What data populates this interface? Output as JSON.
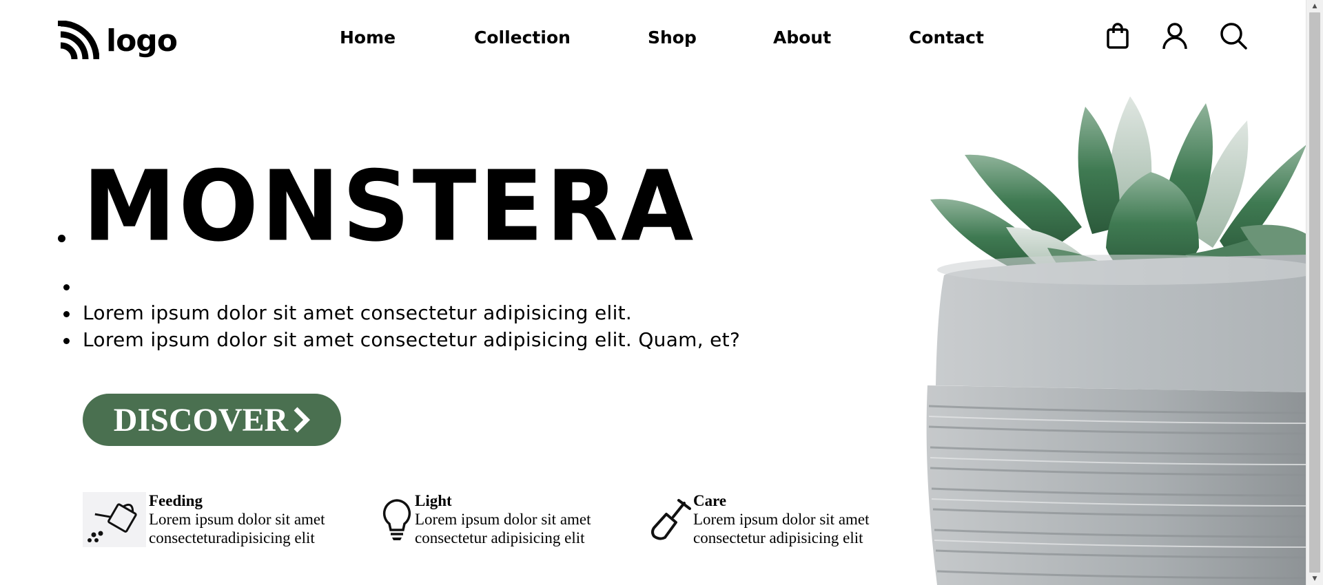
{
  "header": {
    "logo_text": "logo",
    "nav": [
      "Home",
      "Collection",
      "Shop",
      "About",
      "Contact"
    ],
    "icons": [
      "shopping-bag-icon",
      "user-icon",
      "search-icon"
    ]
  },
  "hero": {
    "title": "MONSTERA",
    "lines": [
      "",
      "Lorem ipsum dolor sit amet consectetur adipisicing elit.",
      "Lorem ipsum dolor sit amet consectetur adipisicing elit. Quam, et?"
    ],
    "cta_label": "DISCOVER"
  },
  "features": [
    {
      "icon": "watering-can-icon",
      "title": "Feeding",
      "desc_line1": "Lorem ipsum dolor sit amet",
      "desc_line2": "consecteturadipisicing elit"
    },
    {
      "icon": "lightbulb-icon",
      "title": "Light",
      "desc_line1": "Lorem ipsum dolor sit amet",
      "desc_line2": "consectetur adipisicing elit"
    },
    {
      "icon": "shovel-icon",
      "title": "Care",
      "desc_line1": "Lorem ipsum dolor sit amet",
      "desc_line2": "consectetur adipisicing elit"
    }
  ],
  "colors": {
    "accent": "#4a7050",
    "text": "#000000",
    "background": "#ffffff"
  }
}
